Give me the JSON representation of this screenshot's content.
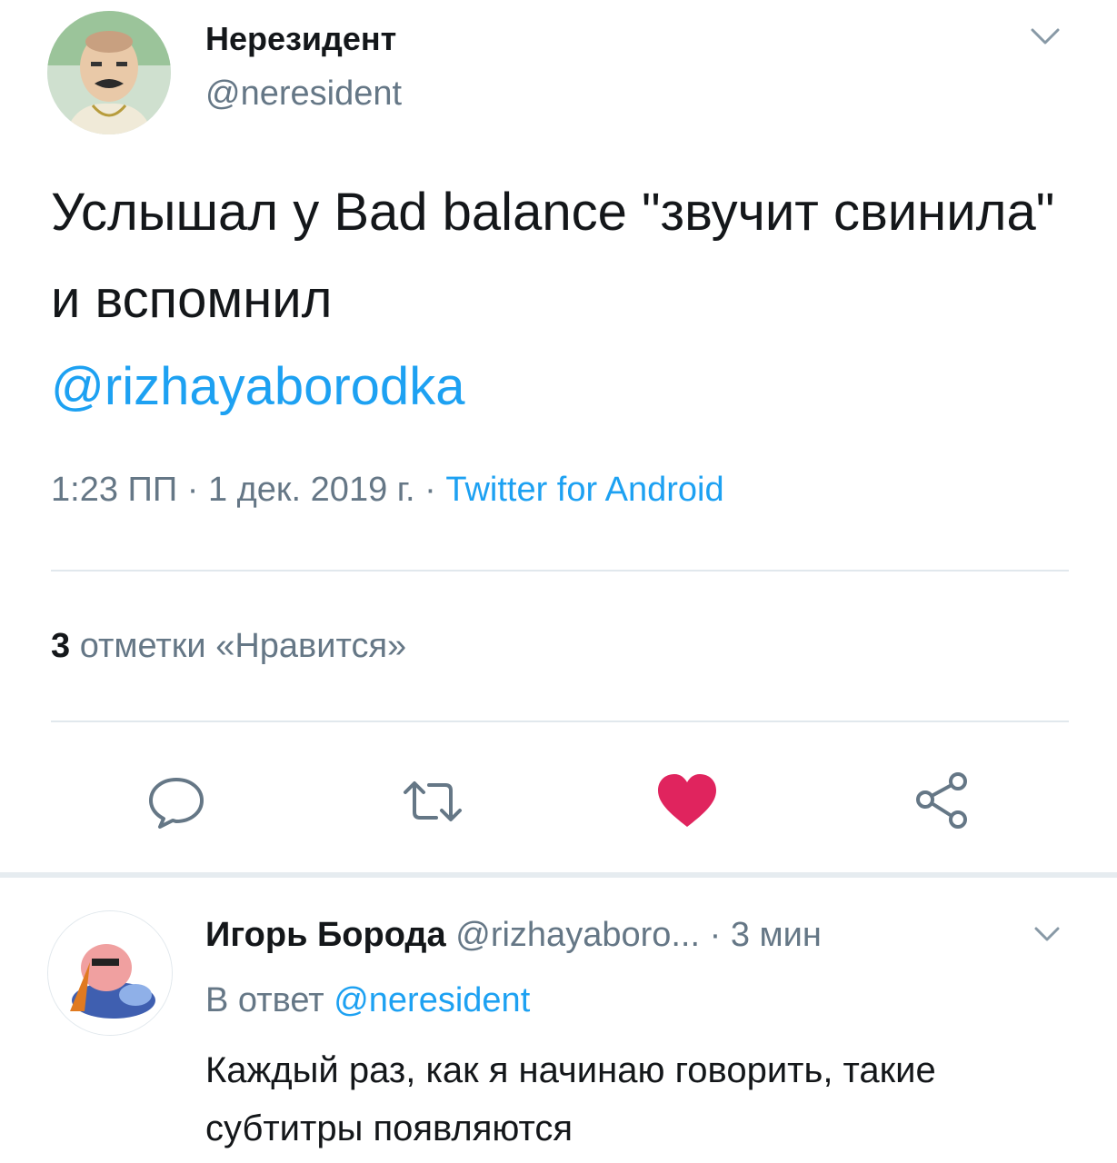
{
  "colors": {
    "accent": "#1da1f2",
    "like": "#e0245e",
    "secondary_text": "#657786",
    "primary_text": "#14171a",
    "divider": "#e1e8ed"
  },
  "tweet": {
    "author_name": "Нерезидент",
    "author_handle": "@neresident",
    "text_part1": "Услышал у Bad balance \"звучит свинила\" и вспомнил",
    "mention": "@rizhayaborodka",
    "time": "1:23 ПП",
    "date": "1 дек. 2019 г.",
    "meta_sep": "·",
    "source": "Twitter for Android",
    "likes_count": "3",
    "likes_label": "отметки «Нравится»",
    "icons": {
      "menu": "chevron-down-icon",
      "reply": "reply-bubble-icon",
      "retweet": "retweet-icon",
      "like": "heart-icon",
      "share": "share-icon"
    }
  },
  "reply": {
    "author_name": "Игорь Борода",
    "author_handle": "@rizhayaboro...",
    "time": "3 мин",
    "sep": "·",
    "reply_prefix": "В ответ",
    "reply_to": "@neresident",
    "text": "Каждый раз, как я начинаю говорить, такие субтитры появляются"
  }
}
